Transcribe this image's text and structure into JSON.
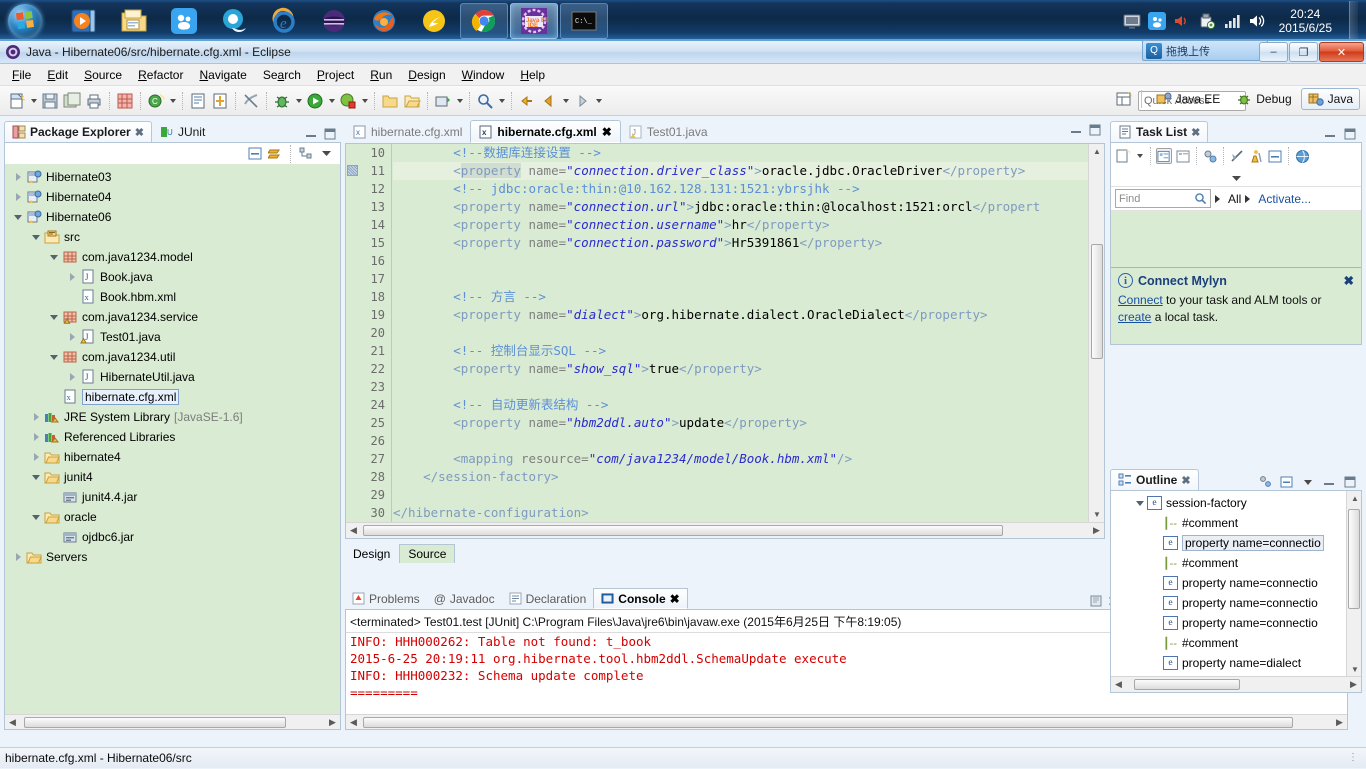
{
  "taskbar": {
    "start_label": "start-orb",
    "items": [
      {
        "name": "media-player",
        "state": "pinned"
      },
      {
        "name": "file-explorer",
        "state": "pinned"
      },
      {
        "name": "baidu-netdisk",
        "state": "pinned"
      },
      {
        "name": "qq-browser",
        "state": "pinned"
      },
      {
        "name": "internet-explorer",
        "state": "pinned"
      },
      {
        "name": "eclipse-purple",
        "state": "pinned"
      },
      {
        "name": "firefox",
        "state": "pinned"
      },
      {
        "name": "thunder-xunlei",
        "state": "pinned"
      },
      {
        "name": "google-chrome",
        "state": "running"
      },
      {
        "name": "eclipse-javaee-ide",
        "state": "active"
      },
      {
        "name": "command-prompt",
        "state": "running"
      }
    ],
    "tray": {
      "icons": [
        "monitor-icon",
        "baidu-icon",
        "speaker-red-icon",
        "usb-eject-icon",
        "network-signal-icon",
        "volume-icon"
      ],
      "time": "20:24",
      "date": "2015/6/25"
    }
  },
  "window": {
    "title": "Java - Hibernate06/src/hibernate.cfg.xml - Eclipse",
    "ime_text": "拖拽上传",
    "minimize": "–",
    "maximize": "❐",
    "close": "✕"
  },
  "menubar": {
    "items": [
      {
        "label": "File",
        "mnemonic": "F"
      },
      {
        "label": "Edit",
        "mnemonic": "E"
      },
      {
        "label": "Source",
        "mnemonic": "S"
      },
      {
        "label": "Refactor",
        "mnemonic": "R"
      },
      {
        "label": "Navigate",
        "mnemonic": "N"
      },
      {
        "label": "Search",
        "mnemonic": "a"
      },
      {
        "label": "Project",
        "mnemonic": "P"
      },
      {
        "label": "Run",
        "mnemonic": "R"
      },
      {
        "label": "Design",
        "mnemonic": "D"
      },
      {
        "label": "Window",
        "mnemonic": "W"
      },
      {
        "label": "Help",
        "mnemonic": "H"
      }
    ]
  },
  "toolbar": {
    "quick_access_placeholder": "Quick Access",
    "perspectives": [
      {
        "label": "Java EE",
        "selected": false
      },
      {
        "label": "Debug",
        "selected": false
      },
      {
        "label": "Java",
        "selected": true
      }
    ]
  },
  "package_explorer": {
    "tabs": [
      {
        "label": "Package Explorer",
        "active": true,
        "closable": true
      },
      {
        "label": "JUnit",
        "active": false,
        "closable": false
      }
    ],
    "tree": [
      {
        "indent": 0,
        "twist": "closed",
        "icon": "java-project-icon",
        "label": "Hibernate03",
        "selected": false
      },
      {
        "indent": 0,
        "twist": "closed",
        "icon": "java-project-icon",
        "label": "Hibernate04",
        "selected": false
      },
      {
        "indent": 0,
        "twist": "open",
        "icon": "java-project-icon",
        "label": "Hibernate06",
        "selected": false
      },
      {
        "indent": 1,
        "twist": "open",
        "icon": "source-folder-icon",
        "label": "src",
        "selected": false
      },
      {
        "indent": 2,
        "twist": "open",
        "icon": "package-icon",
        "label": "com.java1234.model",
        "selected": false
      },
      {
        "indent": 3,
        "twist": "closed",
        "icon": "java-file-icon",
        "label": "Book.java",
        "selected": false
      },
      {
        "indent": 3,
        "twist": "none",
        "icon": "xml-file-icon",
        "label": "Book.hbm.xml",
        "selected": false
      },
      {
        "indent": 2,
        "twist": "open",
        "icon": "package-warn-icon",
        "label": "com.java1234.service",
        "selected": false
      },
      {
        "indent": 3,
        "twist": "closed",
        "icon": "java-warn-icon",
        "label": "Test01.java",
        "selected": false
      },
      {
        "indent": 2,
        "twist": "open",
        "icon": "package-icon",
        "label": "com.java1234.util",
        "selected": false
      },
      {
        "indent": 3,
        "twist": "closed",
        "icon": "java-file-icon",
        "label": "HibernateUtil.java",
        "selected": false
      },
      {
        "indent": 2,
        "twist": "none",
        "icon": "xml-file-icon",
        "label": "hibernate.cfg.xml",
        "selected": true
      },
      {
        "indent": 1,
        "twist": "closed",
        "icon": "library-icon",
        "label": "JRE System Library",
        "suffix": "[JavaSE-1.6]",
        "selected": false
      },
      {
        "indent": 1,
        "twist": "closed",
        "icon": "library-icon",
        "label": "Referenced Libraries",
        "selected": false
      },
      {
        "indent": 1,
        "twist": "closed",
        "icon": "folder-icon",
        "label": "hibernate4",
        "selected": false
      },
      {
        "indent": 1,
        "twist": "open",
        "icon": "folder-icon",
        "label": "junit4",
        "selected": false
      },
      {
        "indent": 2,
        "twist": "none",
        "icon": "jar-icon",
        "label": "junit4.4.jar",
        "selected": false
      },
      {
        "indent": 1,
        "twist": "open",
        "icon": "folder-icon",
        "label": "oracle",
        "selected": false
      },
      {
        "indent": 2,
        "twist": "none",
        "icon": "jar-icon",
        "label": "ojdbc6.jar",
        "selected": false
      },
      {
        "indent": 0,
        "twist": "closed",
        "icon": "folder-icon",
        "label": "Servers",
        "selected": false
      }
    ]
  },
  "editor": {
    "tabs": [
      {
        "label": "hibernate.cfg.xml",
        "icon": "xml-file-icon",
        "active": false,
        "closable": false
      },
      {
        "label": "hibernate.cfg.xml",
        "icon": "xml-file-icon",
        "active": true,
        "closable": true
      },
      {
        "label": "Test01.java",
        "icon": "java-warn-icon",
        "active": false,
        "closable": false
      }
    ],
    "bottom_tabs": [
      {
        "label": "Design",
        "active": false
      },
      {
        "label": "Source",
        "active": true
      }
    ],
    "first_line_number": 10,
    "lines": [
      {
        "n": 10,
        "highlight": false,
        "segs": [
          {
            "t": "\t\t",
            "c": "txt"
          },
          {
            "t": "<!--数据库连接设置 -->",
            "c": "cmt"
          }
        ]
      },
      {
        "n": 11,
        "highlight": true,
        "segs": [
          {
            "t": "\t\t",
            "c": "txt"
          },
          {
            "t": "<",
            "c": "tag"
          },
          {
            "t": "property",
            "c": "tagname-hl"
          },
          {
            "t": " ",
            "c": "tag"
          },
          {
            "t": "name=",
            "c": "attr"
          },
          {
            "t": "\"connection.driver_class\"",
            "c": "val"
          },
          {
            "t": ">",
            "c": "tag"
          },
          {
            "t": "oracle.jdbc.OracleDriver",
            "c": "txt"
          },
          {
            "t": "</property>",
            "c": "tag"
          }
        ]
      },
      {
        "n": 12,
        "highlight": false,
        "segs": [
          {
            "t": "\t\t",
            "c": "txt"
          },
          {
            "t": "<!-- jdbc:oracle:thin:@10.162.128.131:1521:ybrsjhk -->",
            "c": "cmt"
          }
        ]
      },
      {
        "n": 13,
        "highlight": false,
        "segs": [
          {
            "t": "\t\t",
            "c": "txt"
          },
          {
            "t": "<property ",
            "c": "tag"
          },
          {
            "t": "name=",
            "c": "attr"
          },
          {
            "t": "\"connection.url\"",
            "c": "val"
          },
          {
            "t": ">",
            "c": "tag"
          },
          {
            "t": "jdbc:oracle:thin:@localhost:1521:orcl",
            "c": "txt"
          },
          {
            "t": "</propert",
            "c": "tag"
          }
        ]
      },
      {
        "n": 14,
        "highlight": false,
        "segs": [
          {
            "t": "\t\t",
            "c": "txt"
          },
          {
            "t": "<property ",
            "c": "tag"
          },
          {
            "t": "name=",
            "c": "attr"
          },
          {
            "t": "\"connection.username\"",
            "c": "val"
          },
          {
            "t": ">",
            "c": "tag"
          },
          {
            "t": "hr",
            "c": "txt"
          },
          {
            "t": "</property>",
            "c": "tag"
          }
        ]
      },
      {
        "n": 15,
        "highlight": false,
        "segs": [
          {
            "t": "\t\t",
            "c": "txt"
          },
          {
            "t": "<property ",
            "c": "tag"
          },
          {
            "t": "name=",
            "c": "attr"
          },
          {
            "t": "\"connection.password\"",
            "c": "val"
          },
          {
            "t": ">",
            "c": "tag"
          },
          {
            "t": "Hr5391861",
            "c": "txt"
          },
          {
            "t": "</property>",
            "c": "tag"
          }
        ]
      },
      {
        "n": 16,
        "highlight": false,
        "segs": []
      },
      {
        "n": 17,
        "highlight": false,
        "segs": []
      },
      {
        "n": 18,
        "highlight": false,
        "segs": [
          {
            "t": "\t\t",
            "c": "txt"
          },
          {
            "t": "<!-- 方言 -->",
            "c": "cmt"
          }
        ]
      },
      {
        "n": 19,
        "highlight": false,
        "segs": [
          {
            "t": "\t\t",
            "c": "txt"
          },
          {
            "t": "<property ",
            "c": "tag"
          },
          {
            "t": "name=",
            "c": "attr"
          },
          {
            "t": "\"dialect\"",
            "c": "val"
          },
          {
            "t": ">",
            "c": "tag"
          },
          {
            "t": "org.hibernate.dialect.OracleDialect",
            "c": "txt"
          },
          {
            "t": "</property>",
            "c": "tag"
          }
        ]
      },
      {
        "n": 20,
        "highlight": false,
        "segs": []
      },
      {
        "n": 21,
        "highlight": false,
        "segs": [
          {
            "t": "\t\t",
            "c": "txt"
          },
          {
            "t": "<!-- 控制台显示SQL -->",
            "c": "cmt"
          }
        ]
      },
      {
        "n": 22,
        "highlight": false,
        "segs": [
          {
            "t": "\t\t",
            "c": "txt"
          },
          {
            "t": "<property ",
            "c": "tag"
          },
          {
            "t": "name=",
            "c": "attr"
          },
          {
            "t": "\"show_sql\"",
            "c": "val"
          },
          {
            "t": ">",
            "c": "tag"
          },
          {
            "t": "true",
            "c": "txt"
          },
          {
            "t": "</property>",
            "c": "tag"
          }
        ]
      },
      {
        "n": 23,
        "highlight": false,
        "segs": []
      },
      {
        "n": 24,
        "highlight": false,
        "segs": [
          {
            "t": "\t\t",
            "c": "txt"
          },
          {
            "t": "<!-- 自动更新表结构 -->",
            "c": "cmt"
          }
        ]
      },
      {
        "n": 25,
        "highlight": false,
        "segs": [
          {
            "t": "\t\t",
            "c": "txt"
          },
          {
            "t": "<property ",
            "c": "tag"
          },
          {
            "t": "name=",
            "c": "attr"
          },
          {
            "t": "\"hbm2ddl.auto\"",
            "c": "val"
          },
          {
            "t": ">",
            "c": "tag"
          },
          {
            "t": "update",
            "c": "txt"
          },
          {
            "t": "</property>",
            "c": "tag"
          }
        ]
      },
      {
        "n": 26,
        "highlight": false,
        "segs": []
      },
      {
        "n": 27,
        "highlight": false,
        "segs": [
          {
            "t": "\t\t",
            "c": "txt"
          },
          {
            "t": "<mapping ",
            "c": "tag"
          },
          {
            "t": "resource=",
            "c": "attr"
          },
          {
            "t": "\"com/java1234/model/Book.hbm.xml\"",
            "c": "val"
          },
          {
            "t": "/>",
            "c": "tag"
          }
        ]
      },
      {
        "n": 28,
        "highlight": false,
        "segs": [
          {
            "t": "\t",
            "c": "txt"
          },
          {
            "t": "</session-factory>",
            "c": "tag"
          }
        ]
      },
      {
        "n": 29,
        "highlight": false,
        "segs": []
      },
      {
        "n": 30,
        "highlight": false,
        "segs": [
          {
            "t": "</hibernate-configuration>",
            "c": "tag"
          }
        ]
      }
    ]
  },
  "console": {
    "tabs": [
      {
        "label": "Problems",
        "icon": "problems-icon",
        "active": false
      },
      {
        "label": "Javadoc",
        "icon": "javadoc-icon",
        "active": false
      },
      {
        "label": "Declaration",
        "icon": "declaration-icon",
        "active": false
      },
      {
        "label": "Console",
        "icon": "console-icon",
        "active": true,
        "closable": true
      }
    ],
    "header": "<terminated> Test01.test [JUnit] C:\\Program Files\\Java\\jre6\\bin\\javaw.exe (2015年6月25日 下午8:19:05)",
    "lines": [
      "INFO: HHH000262: Table not found: t_book",
      "2015-6-25 20:19:11 org.hibernate.tool.hbm2ddl.SchemaUpdate execute",
      "INFO: HHH000232: Schema update complete",
      "========="
    ],
    "text_color": "#d40000"
  },
  "task_list": {
    "tabs": [
      {
        "label": "Task List",
        "active": true,
        "closable": true
      }
    ],
    "find_placeholder": "Find",
    "filter_all": "All",
    "activate_label": "Activate...",
    "mylyn": {
      "title": "Connect Mylyn",
      "link1": "Connect",
      "mid_text": " to your task and ALM tools or ",
      "link2": "create",
      "end_text": " a local task."
    }
  },
  "outline": {
    "tabs": [
      {
        "label": "Outline",
        "active": true,
        "closable": true
      }
    ],
    "rows": [
      {
        "indent": 1,
        "twist": "open",
        "type": "element",
        "label": "session-factory",
        "selected": false
      },
      {
        "indent": 2,
        "twist": "none",
        "type": "comment",
        "label": "#comment",
        "selected": false
      },
      {
        "indent": 2,
        "twist": "none",
        "type": "element",
        "label": "property name=connectio",
        "selected": true
      },
      {
        "indent": 2,
        "twist": "none",
        "type": "comment",
        "label": "#comment",
        "selected": false
      },
      {
        "indent": 2,
        "twist": "none",
        "type": "element",
        "label": "property name=connectio",
        "selected": false
      },
      {
        "indent": 2,
        "twist": "none",
        "type": "element",
        "label": "property name=connectio",
        "selected": false
      },
      {
        "indent": 2,
        "twist": "none",
        "type": "element",
        "label": "property name=connectio",
        "selected": false
      },
      {
        "indent": 2,
        "twist": "none",
        "type": "comment",
        "label": "#comment",
        "selected": false
      },
      {
        "indent": 2,
        "twist": "none",
        "type": "element",
        "label": "property name=dialect",
        "selected": false
      }
    ]
  },
  "status_bar": {
    "text": "hibernate.cfg.xml - Hibernate06/src"
  },
  "colors": {
    "editor_background": "#d9ebd2",
    "panel_background": "#d9ebd2",
    "console_error": "#d40000",
    "link": "#1a4fa0",
    "selection": "#e7f0fb"
  }
}
